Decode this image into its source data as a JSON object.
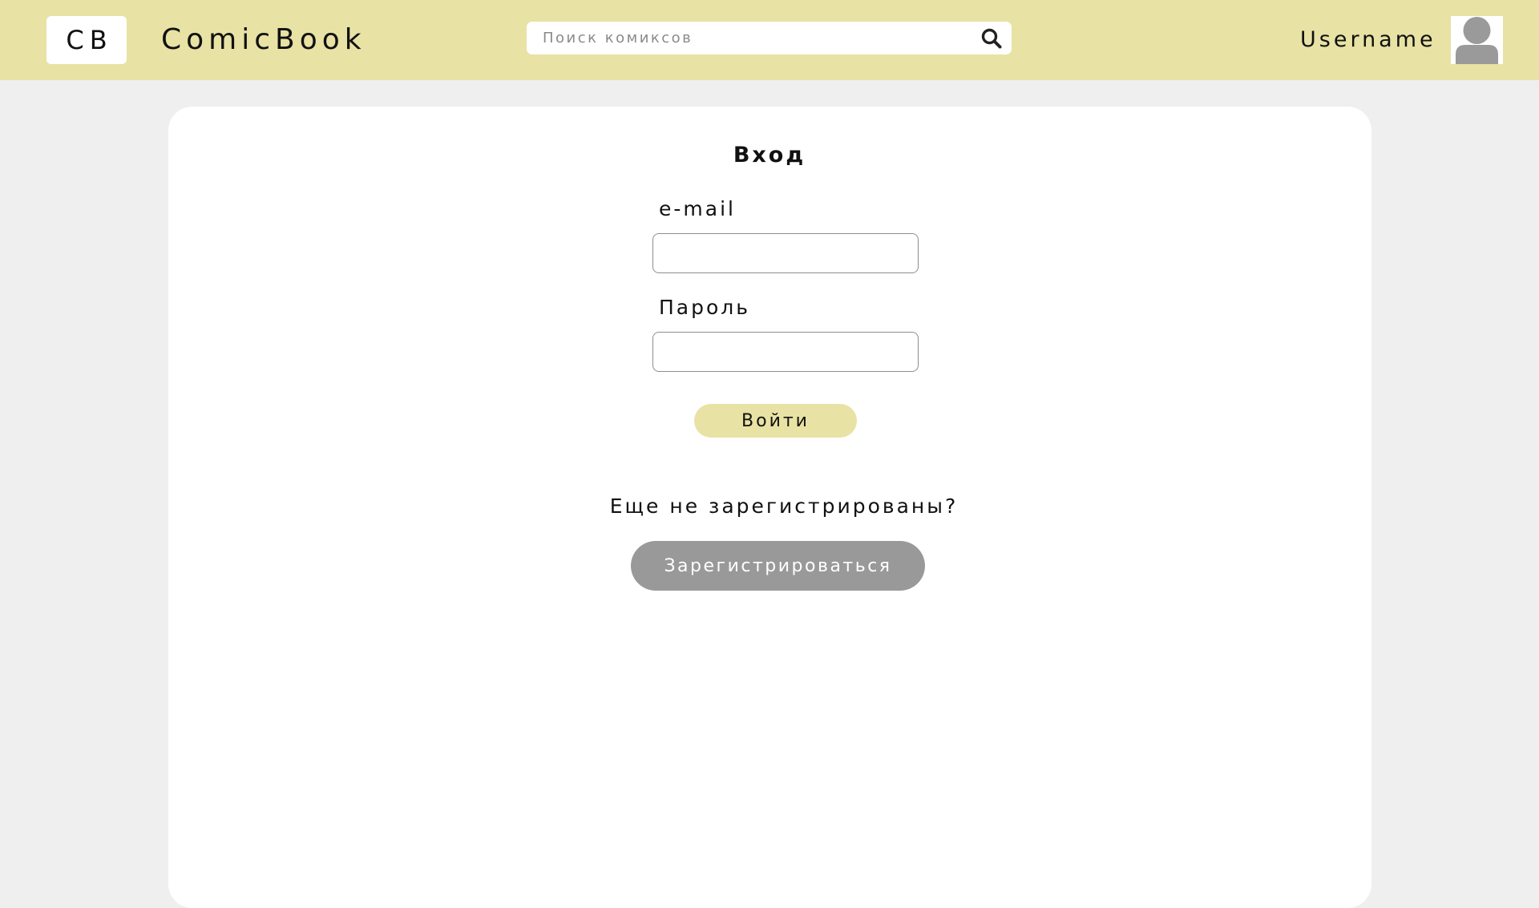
{
  "header": {
    "logo_text": "CB",
    "brand_name": "ComicBook",
    "search": {
      "placeholder": "Поиск комиксов",
      "value": "",
      "icon": "search-icon"
    },
    "username": "Username",
    "avatar_icon": "user-avatar-icon"
  },
  "login_form": {
    "title": "Вход",
    "email_label": "e-mail",
    "email_value": "",
    "password_label": "Пароль",
    "password_value": "",
    "submit_label": "Войти"
  },
  "register": {
    "prompt": "Еще не зарегистрированы?",
    "button_label": "Зарегистрироваться"
  },
  "colors": {
    "header_bg": "#e8e2a4",
    "page_bg": "#efefef",
    "card_bg": "#ffffff",
    "login_button_bg": "#e8e2a4",
    "register_button_bg": "#999999"
  }
}
